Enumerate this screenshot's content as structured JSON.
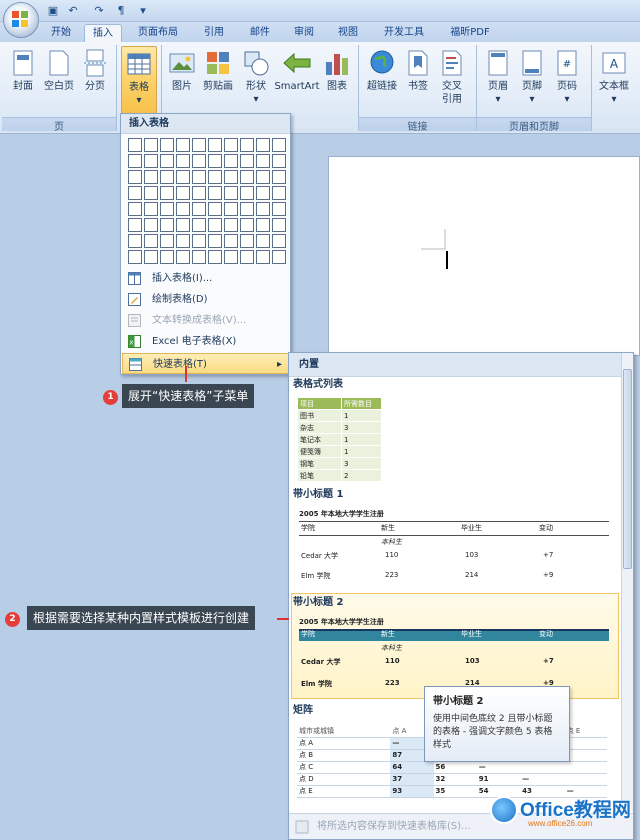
{
  "qat": {
    "menu_arrow": "▾"
  },
  "tabs": [
    {
      "label": "开始"
    },
    {
      "label": "插入"
    },
    {
      "label": "页面布局"
    },
    {
      "label": "引用"
    },
    {
      "label": "邮件"
    },
    {
      "label": "审阅"
    },
    {
      "label": "视图"
    },
    {
      "label": "开发工具"
    },
    {
      "label": "福昕PDF"
    }
  ],
  "ribbon": {
    "buttons": {
      "cover": "封面",
      "blank": "空白页",
      "break": "分页",
      "table": "表格",
      "picture": "图片",
      "clipart": "剪贴画",
      "shapes": "形状",
      "smartart": "SmartArt",
      "chart": "图表",
      "hyperlink": "超链接",
      "bookmark": "书签",
      "crossref": "交叉引用",
      "header": "页眉",
      "footer": "页脚",
      "pagenum": "页码",
      "textbox": "文本框"
    },
    "groups": {
      "pages": "页",
      "links": "链接",
      "header_footer": "页眉和页脚"
    }
  },
  "dropdown": {
    "title": "插入表格",
    "items": [
      {
        "label": "插入表格(I)..."
      },
      {
        "label": "绘制表格(D)"
      },
      {
        "label": "文本转换成表格(V)..."
      },
      {
        "label": "Excel 电子表格(X)"
      },
      {
        "label": "快速表格(T)"
      }
    ]
  },
  "gallery": {
    "header": "内置",
    "sections": {
      "list": "表格式列表",
      "sub1": "带小标题 1",
      "sub2": "带小标题 2",
      "matrix": "矩阵"
    },
    "list_table": {
      "head": [
        "项目",
        "所需数目"
      ],
      "rows": [
        [
          "图书",
          "1"
        ],
        [
          "杂志",
          "3"
        ],
        [
          "笔记本",
          "1"
        ],
        [
          "便笺簿",
          "1"
        ],
        [
          "钢笔",
          "3"
        ],
        [
          "铅笔",
          "2"
        ]
      ]
    },
    "sub_table": {
      "caption": "2005 年本地大学学生注册",
      "head": [
        "学院",
        "新生",
        "毕业生",
        "变动"
      ],
      "subhead": "本科生",
      "rows": [
        [
          "Cedar 大学",
          "110",
          "103",
          "+7"
        ],
        [
          "Elm 学院",
          "223",
          "214",
          "+9"
        ]
      ]
    },
    "matrix_table": {
      "head": [
        "城市或城镇",
        "点 A",
        "点 B",
        "点 C",
        "点 D",
        "点 E"
      ],
      "rows": [
        [
          "点 A",
          "—",
          "",
          "",
          "",
          ""
        ],
        [
          "点 B",
          "87",
          "",
          "",
          "",
          ""
        ],
        [
          "点 C",
          "64",
          "56",
          "—",
          "",
          ""
        ],
        [
          "点 D",
          "37",
          "32",
          "91",
          "—",
          ""
        ],
        [
          "点 E",
          "93",
          "35",
          "54",
          "43",
          "—"
        ]
      ]
    },
    "footer": "将所选内容保存到快速表格库(S)..."
  },
  "tooltip": {
    "title": "带小标题 2",
    "body": "使用中间色底纹 2 且带小标题的表格 - 强调文字颜色 5 表格样式"
  },
  "callouts": {
    "one": {
      "num": "1",
      "text": "展开“快速表格”子菜单"
    },
    "two": {
      "num": "2",
      "text": "根据需要选择某种内置样式模板进行创建"
    }
  },
  "watermark": {
    "brand": "Office教程网",
    "url": "www.office26.com"
  },
  "colors": {
    "accent_blue": "#4bacc6",
    "accent_green": "#9bbb59",
    "highlight": "#fbd26a"
  }
}
